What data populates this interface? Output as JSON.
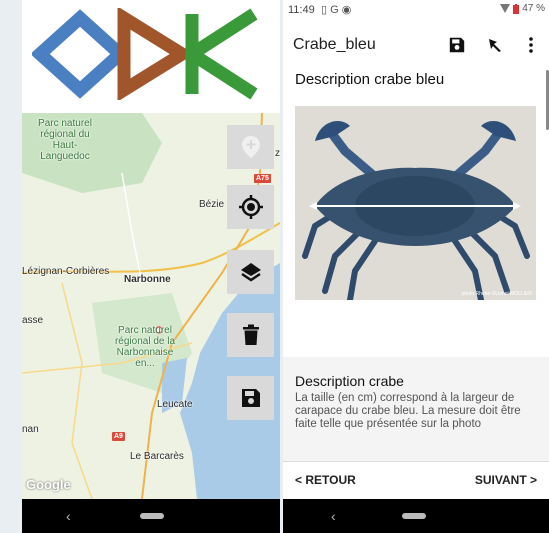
{
  "left_screen": {
    "map": {
      "labels": {
        "park_haut_languedoc": "Parc naturel\nrégional du\nHaut-Languedoc",
        "beziers": "Bézie",
        "beziers_partial": "z",
        "lezignan": "Lézignan-Corbières",
        "narbonne": "Narbonne",
        "asse": "asse",
        "park_narbonnaise": "Parc naturel\nrégional de la\nNarbonnaise\nen...",
        "leucate": "Leucate",
        "nan": "nan",
        "le_barcares": "Le Barcarès",
        "a75": "A75",
        "a9": "A9",
        "google": "Google"
      },
      "buttons": [
        {
          "name": "add-marker-button",
          "icon": "map-pin-plus-icon",
          "enabled": false
        },
        {
          "name": "locate-me-button",
          "icon": "crosshair-gps-icon",
          "enabled": true
        },
        {
          "name": "layers-button",
          "icon": "layers-icon",
          "enabled": true
        },
        {
          "name": "delete-button",
          "icon": "trash-icon",
          "enabled": true
        },
        {
          "name": "save-button",
          "icon": "floppy-disk-icon",
          "enabled": true
        }
      ]
    },
    "nav": {
      "back": "‹"
    }
  },
  "right_screen": {
    "status": {
      "time": "11:49",
      "icons": "▯ G ◉",
      "battery": "47 %"
    },
    "appbar": {
      "title": "Crabe_bleu",
      "icons": [
        "floppy-disk-icon",
        "pointer-icon",
        "more-vert-icon"
      ]
    },
    "section_title": "Description crabe bleu",
    "photo_credit": "photo Rhone ©Lionel MOLLIER",
    "description": {
      "title": "Description crabe",
      "text": "La taille (en cm) correspond à la largeur de carapace du crabe bleu. La mesure doit être faite telle que présentée sur la photo"
    },
    "footer": {
      "back": "RETOUR",
      "next": "SUIVANT"
    },
    "nav": {
      "back": "‹"
    }
  },
  "colors": {
    "accent_blue": "#4a7fc1",
    "accent_brown": "#a0552a",
    "accent_green": "#3a9a3a",
    "sea": "#a9cbe8",
    "road_red": "#d94a3a"
  }
}
